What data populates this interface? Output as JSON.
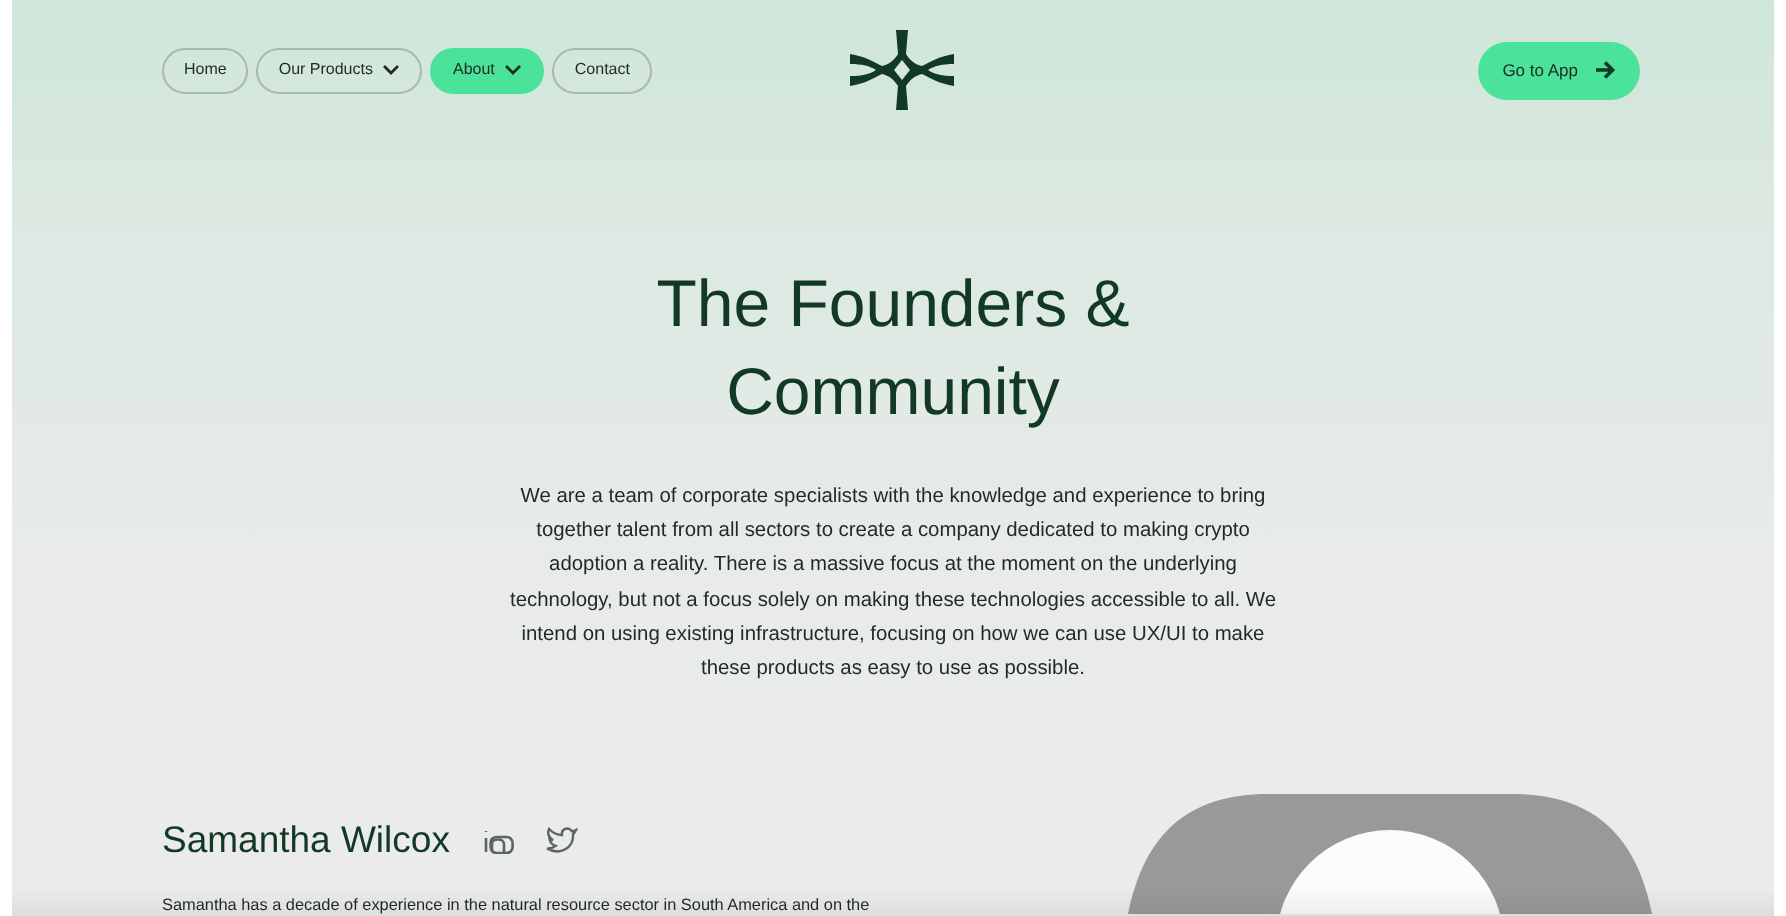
{
  "nav": {
    "items": [
      {
        "label": "Home",
        "selected": false,
        "dropdown": false
      },
      {
        "label": "Our Products",
        "selected": false,
        "dropdown": true
      },
      {
        "label": "About",
        "selected": true,
        "dropdown": true
      },
      {
        "label": "Contact",
        "selected": false,
        "dropdown": false
      }
    ],
    "cta": {
      "label": "Go to App"
    }
  },
  "hero": {
    "title_lines": [
      "The Founders &",
      "Community"
    ],
    "text": "We are a team of corporate specialists with the knowledge and experience to bring together talent from all sectors to create a company dedicated to making crypto adoption a reality. There is a massive focus at the moment on the underlying technology, but not a focus solely on making these technologies accessible to all. We intend on using existing infrastructure, focusing on how we can use UX/UI to make these products as easy to use as possible."
  },
  "founder": {
    "name": "Samantha Wilcox",
    "bio": "Samantha has a decade of experience in the natural resource sector in South America and on the"
  }
}
